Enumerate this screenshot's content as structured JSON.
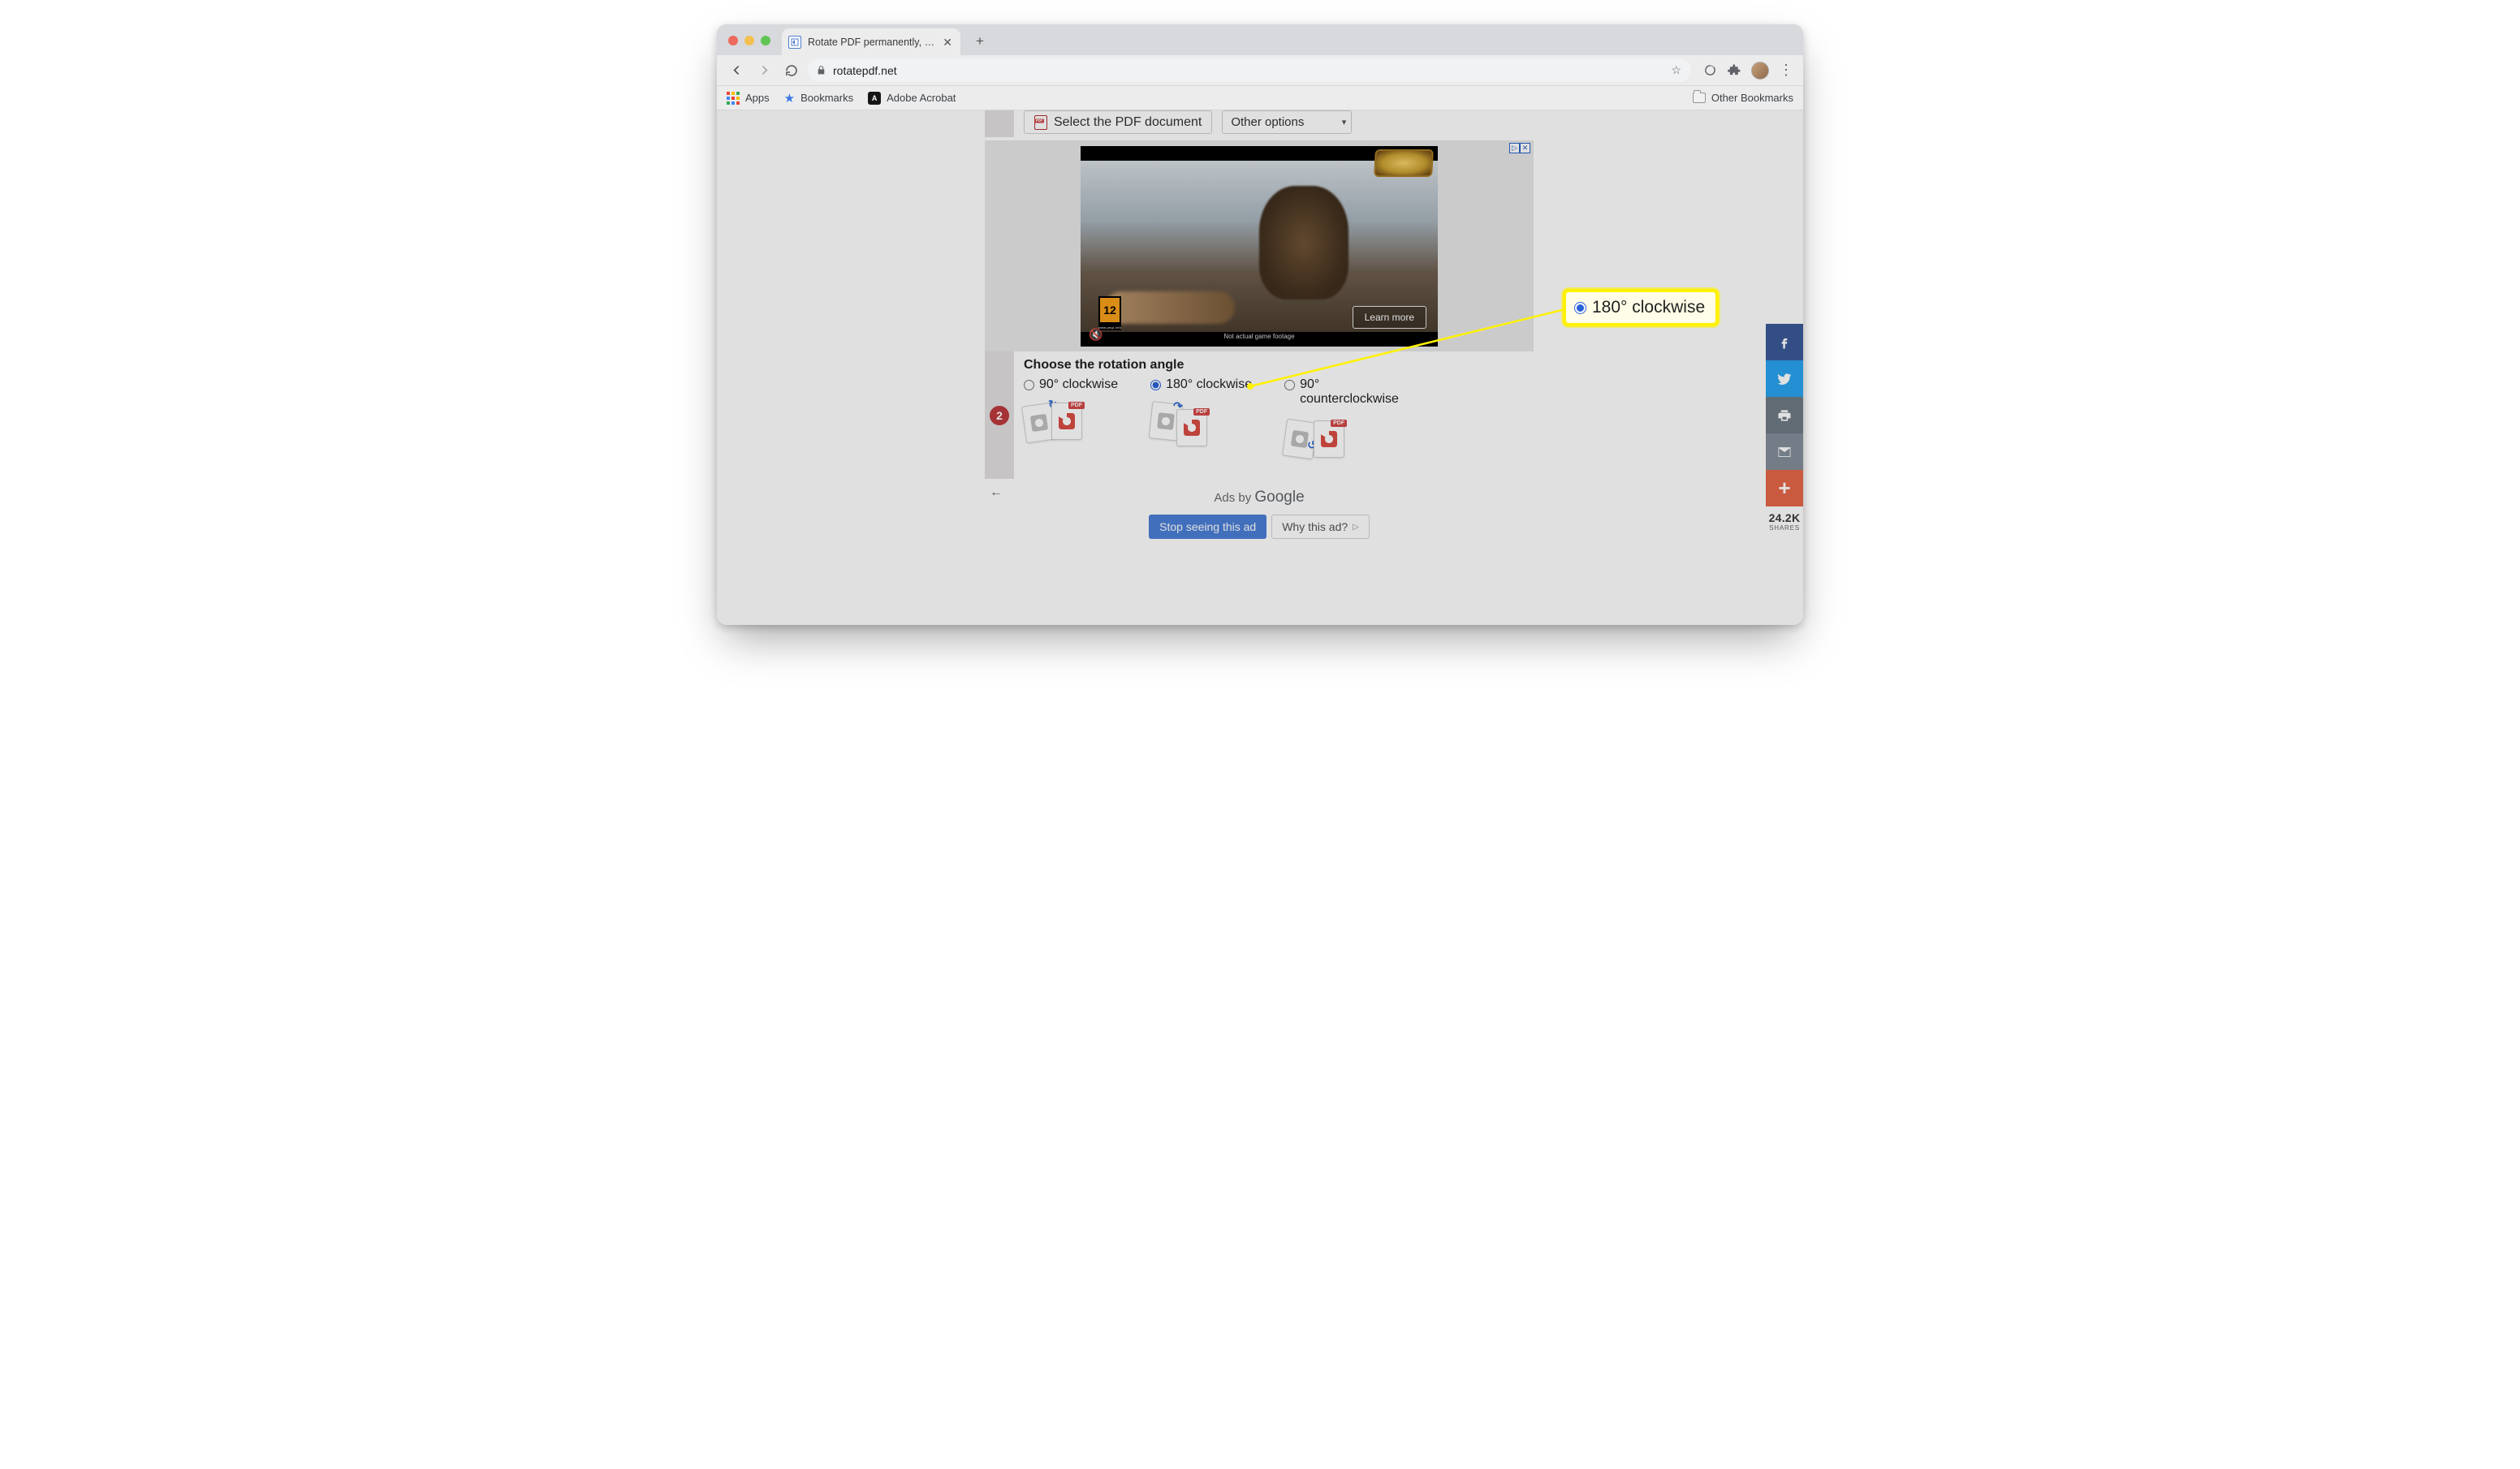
{
  "tab": {
    "title": "Rotate PDF permanently, online"
  },
  "address": {
    "url": "rotatepdf.net"
  },
  "toolbar_icons": [
    "progress-icon",
    "extensions-icon",
    "avatar-icon",
    "menu-icon"
  ],
  "bookmarks_bar": {
    "apps": "Apps",
    "bookmarks": "Bookmarks",
    "adobe": "Adobe Acrobat",
    "other": "Other Bookmarks"
  },
  "step1": {
    "select_label": "Select the PDF document",
    "other_options_label": "Other options"
  },
  "ad_banner": {
    "learn_more": "Learn more",
    "footage_note": "Not actual game footage",
    "pegi": "12",
    "pegi_site": "www.pegi.info"
  },
  "step2": {
    "number": "2",
    "heading": "Choose the rotation angle",
    "options": {
      "cw90": "90° clockwise",
      "cw180": "180° clockwise",
      "ccw90": "90° counterclockwise"
    },
    "selected": "cw180"
  },
  "google_ad": {
    "ads_by": "Ads by",
    "brand": "Google",
    "stop": "Stop seeing this ad",
    "why": "Why this ad?"
  },
  "shares": {
    "count": "24.2K",
    "label": "SHARES"
  },
  "callout": {
    "label": "180° clockwise"
  }
}
